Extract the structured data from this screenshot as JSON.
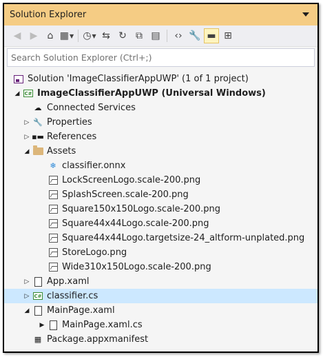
{
  "panel": {
    "title": "Solution Explorer",
    "search_placeholder": "Search Solution Explorer (Ctrl+;)"
  },
  "toolbar": {
    "icons": [
      "back-icon",
      "forward-icon",
      "home-icon",
      "switch-views-icon",
      "pending-changes-filter-icon",
      "sync-icon",
      "refresh-icon",
      "collapse-all-icon",
      "show-all-files-icon",
      "view-code-icon",
      "properties-icon",
      "preview-selected-icon",
      "class-view-icon"
    ]
  },
  "tree": {
    "solution": "Solution 'ImageClassifierAppUWP' (1 of 1 project)",
    "project": "ImageClassifierAppUWP (Universal Windows)",
    "connected_services": "Connected Services",
    "properties": "Properties",
    "references": "References",
    "assets": "Assets",
    "asset_files": [
      "classifier.onnx",
      "LockScreenLogo.scale-200.png",
      "SplashScreen.scale-200.png",
      "Square150x150Logo.scale-200.png",
      "Square44x44Logo.scale-200.png",
      "Square44x44Logo.targetsize-24_altform-unplated.png",
      "StoreLogo.png",
      "Wide310x150Logo.scale-200.png"
    ],
    "app_xaml": "App.xaml",
    "classifier_cs": "classifier.cs",
    "mainpage_xaml": "MainPage.xaml",
    "mainpage_xaml_cs": "MainPage.xaml.cs",
    "manifest": "Package.appxmanifest"
  },
  "colors": {
    "title_bar": "#f5cc84",
    "selection": "#cce8ff",
    "cs_icon": "#388a34",
    "folder": "#dcb67a"
  }
}
